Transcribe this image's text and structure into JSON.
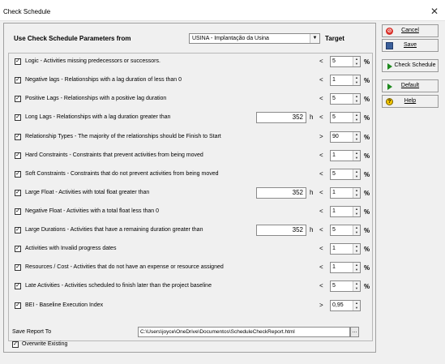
{
  "window": {
    "title": "Check Schedule",
    "close": "✕"
  },
  "header": {
    "label": "Use Check Schedule Parameters from",
    "combo_value": "USINA - Implantação da Usina",
    "target_label": "Target"
  },
  "rows": [
    {
      "checked": true,
      "desc": "Logic - Activities missing predecessors or successors.",
      "hours": null,
      "op": "<",
      "value": "5",
      "pct": "%"
    },
    {
      "checked": true,
      "desc": "Negative lags - Relationships with a lag duration of less than 0",
      "hours": null,
      "op": "<",
      "value": "1",
      "pct": "%"
    },
    {
      "checked": true,
      "desc": "Positive Lags - Relationships with a positive lag duration",
      "hours": null,
      "op": "<",
      "value": "5",
      "pct": "%"
    },
    {
      "checked": true,
      "desc": "Long Lags - Relationships with a lag duration greater than",
      "hours": "352",
      "op": "<",
      "value": "5",
      "pct": "%"
    },
    {
      "checked": true,
      "desc": "Relationship Types - The majority of the relationships should be Finish to Start",
      "hours": null,
      "op": ">",
      "value": "90",
      "pct": "%"
    },
    {
      "checked": true,
      "desc": "Hard Constraints - Constraints that prevent activities from being moved",
      "hours": null,
      "op": "<",
      "value": "1",
      "pct": "%"
    },
    {
      "checked": true,
      "desc": "Soft Constraints - Constraints that do not prevent activities from being moved",
      "hours": null,
      "op": "<",
      "value": "5",
      "pct": "%"
    },
    {
      "checked": true,
      "desc": "Large Float - Activities with total float greater than",
      "hours": "352",
      "op": "<",
      "value": "1",
      "pct": "%"
    },
    {
      "checked": true,
      "desc": "Negative Float - Activities with a total float less than 0",
      "hours": null,
      "op": "<",
      "value": "1",
      "pct": "%"
    },
    {
      "checked": true,
      "desc": "Large Durations - Activities that have a remaining duration greater than",
      "hours": "352",
      "op": "<",
      "value": "5",
      "pct": "%"
    },
    {
      "checked": true,
      "desc": "Activities with Invalid progress dates",
      "hours": null,
      "op": "<",
      "value": "1",
      "pct": "%"
    },
    {
      "checked": true,
      "desc": "Resources / Cost - Activities that do not have an expense or resource assigned",
      "hours": null,
      "op": "<",
      "value": "1",
      "pct": "%"
    },
    {
      "checked": true,
      "desc": "Late Activities - Activities scheduled to finish later than the project baseline",
      "hours": null,
      "op": "<",
      "value": "5",
      "pct": "%"
    },
    {
      "checked": true,
      "desc": "BEI - Baseline Execution Index",
      "hours": null,
      "op": ">",
      "value": "0,95",
      "pct": ""
    }
  ],
  "hours_unit": "h",
  "footer": {
    "save_report_label": "Save Report To",
    "path": "C:\\Users\\joyce\\OneDrive\\Documentos\\ScheduleCheckReport.html",
    "browse": "...",
    "overwrite_label": "Overwrite Existing",
    "overwrite_checked": true
  },
  "side_buttons": [
    {
      "label": "Cancel",
      "icon": "cancel-icon"
    },
    {
      "label": "Save",
      "icon": "save-icon"
    },
    {
      "label": "Check Schedule",
      "icon": "run-arrow-icon"
    },
    {
      "label": "Default",
      "icon": "run-arrow-icon"
    },
    {
      "label": "Help",
      "icon": "help-icon"
    }
  ]
}
